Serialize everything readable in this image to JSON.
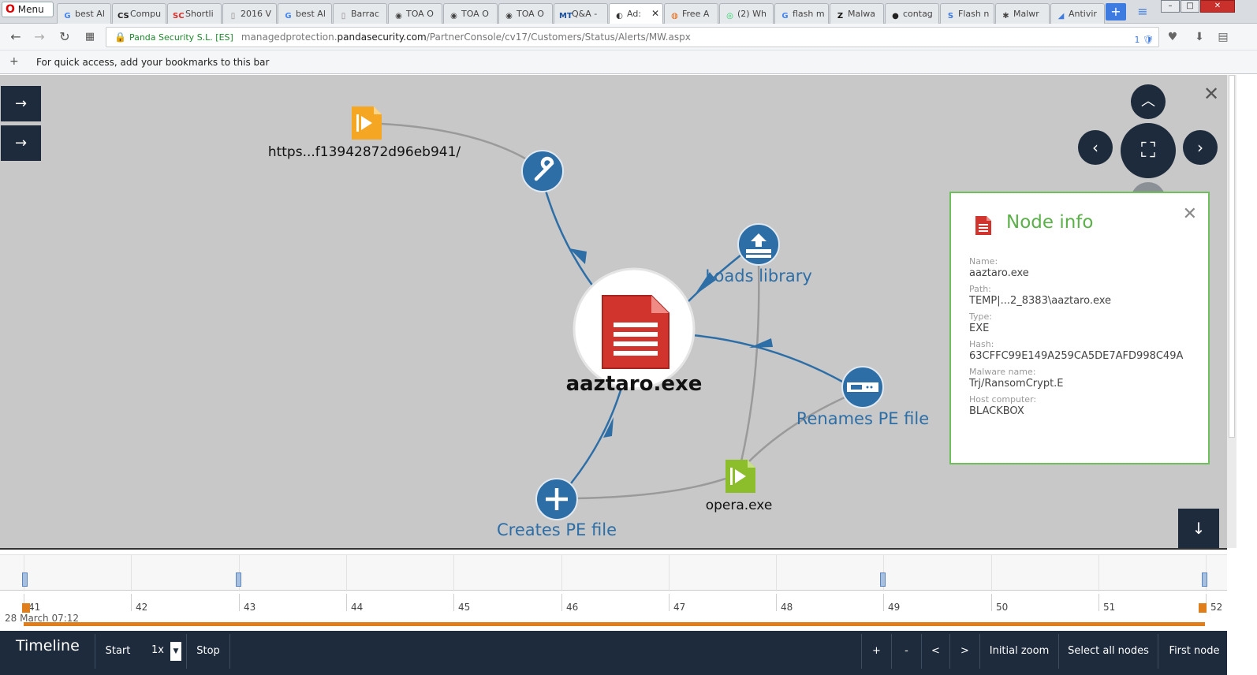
{
  "browser": {
    "menu_label": "Menu",
    "tabs": [
      {
        "label": "best Al",
        "icon": "google-icon",
        "color": "#4285f4"
      },
      {
        "label": "Compu",
        "icon": "cs-icon",
        "color": "#222222"
      },
      {
        "label": "Shortli",
        "icon": "sc-icon",
        "color": "#d9302a"
      },
      {
        "label": "2016 V",
        "icon": "page-icon",
        "color": "#888888"
      },
      {
        "label": "best Al",
        "icon": "google-icon",
        "color": "#4285f4"
      },
      {
        "label": "Barrac",
        "icon": "page-icon",
        "color": "#888888"
      },
      {
        "label": "TOA O",
        "icon": "toa-icon",
        "color": "#444444"
      },
      {
        "label": "TOA O",
        "icon": "toa-icon",
        "color": "#444444"
      },
      {
        "label": "TOA O",
        "icon": "toa-icon",
        "color": "#444444"
      },
      {
        "label": "Q&A -",
        "icon": "mt-icon",
        "color": "#1a4fa0"
      },
      {
        "label": "Ad:",
        "icon": "panda-icon",
        "color": "#333333",
        "active": true
      },
      {
        "label": "Free A",
        "icon": "firefox-icon",
        "color": "#e66000"
      },
      {
        "label": "(2) Wh",
        "icon": "whatsapp-icon",
        "color": "#25d366"
      },
      {
        "label": "flash m",
        "icon": "google-icon",
        "color": "#4285f4"
      },
      {
        "label": "Malwa",
        "icon": "z-icon",
        "color": "#111111"
      },
      {
        "label": "contag",
        "icon": "drop-icon",
        "color": "#222222"
      },
      {
        "label": "Flash n",
        "icon": "s-icon",
        "color": "#3d7be0"
      },
      {
        "label": "Malwr",
        "icon": "bug-icon",
        "color": "#444444"
      },
      {
        "label": "Antivir",
        "icon": "avast-icon",
        "color": "#3d7be0"
      }
    ],
    "url": {
      "lock_label": "Panda Security S.L. [ES]",
      "prefix": "managedprotection.",
      "domain": "pandasecurity.com",
      "path": "/PartnerConsole/cv17/Customers/Status/Alerts/MW.aspx",
      "badge": "1"
    },
    "bookmarks_hint": "For quick access, add your bookmarks to this bar"
  },
  "graph": {
    "nodes": {
      "center": "aaztaro.exe",
      "url": "https...f13942872d96eb941/",
      "loads": "Loads library",
      "renames": "Renames PE file",
      "creates": "Creates PE file",
      "opera": "opera.exe"
    },
    "colors": {
      "edge_blue": "#2d6ea6",
      "edge_gray": "#9a9a9a",
      "node_dark": "#2d6ea6",
      "exe_red": "#d0342c",
      "file_orange": "#f5a623",
      "file_green": "#8cbd2a"
    }
  },
  "node_info": {
    "title": "Node info",
    "fields": [
      {
        "label": "Name:",
        "value": "aaztaro.exe"
      },
      {
        "label": "Path:",
        "value": "TEMP|...2_8383\\aaztaro.exe"
      },
      {
        "label": "Type:",
        "value": "EXE"
      },
      {
        "label": "Hash:",
        "value": "63CFFC99E149A259CA5DE7AFD998C49A"
      },
      {
        "label": "Malware name:",
        "value": "Trj/RansomCrypt.E"
      },
      {
        "label": "Host computer:",
        "value": "BLACKBOX"
      }
    ]
  },
  "timeline": {
    "date": "28 March 07:12",
    "ticks": [
      "41",
      "42",
      "43",
      "44",
      "45",
      "46",
      "47",
      "48",
      "49",
      "50",
      "51",
      "52"
    ],
    "title": "Timeline",
    "start_label": "Start",
    "speed": "1x",
    "stop_label": "Stop",
    "zoom_in": "+",
    "zoom_out": "-",
    "prev": "<",
    "next": ">",
    "initial_zoom": "Initial zoom",
    "select_all": "Select all nodes",
    "first_node": "First node"
  }
}
